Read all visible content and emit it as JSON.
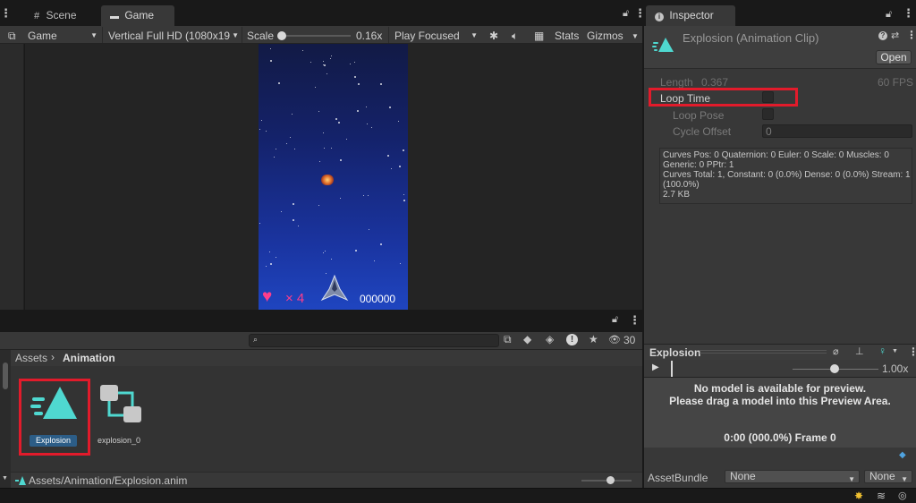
{
  "tabs": {
    "scene": "Scene",
    "game": "Game",
    "inspector": "Inspector"
  },
  "game_toolbar": {
    "display": "Game",
    "resolution": "Vertical Full HD (1080x19",
    "scale_label": "Scale",
    "scale_value": "0.16x",
    "play_mode": "Play Focused",
    "stats": "Stats",
    "gizmos": "Gizmos"
  },
  "game_hud": {
    "lives": "× 4",
    "score": "000000"
  },
  "project": {
    "search_placeholder": "",
    "visible_count": "30",
    "breadcrumb_root": "Assets",
    "breadcrumb_current": "Animation",
    "assets": [
      {
        "name": "Explosion",
        "selected": true,
        "icon": "animation-clip-icon"
      },
      {
        "name": "explosion_0",
        "selected": false,
        "icon": "animator-controller-icon"
      }
    ],
    "footer_path": "Assets/Animation/Explosion.anim"
  },
  "inspector": {
    "title": "Explosion (Animation Clip)",
    "open_button": "Open",
    "length_label": "Length",
    "length_value": "0.367",
    "fps": "60 FPS",
    "loop_time_label": "Loop Time",
    "loop_time_checked": false,
    "loop_pose_label": "Loop Pose",
    "cycle_offset_label": "Cycle Offset",
    "cycle_offset_value": "0",
    "info_line1": "Curves Pos: 0 Quaternion: 0 Euler: 0 Scale: 0 Muscles: 0",
    "info_line2": "Generic: 0 PPtr: 1",
    "info_line3": "Curves Total: 1, Constant: 0 (0.0%) Dense: 0 (0.0%) Stream: 1",
    "info_line4": "(100.0%)",
    "info_line5": "2.7 KB"
  },
  "preview": {
    "title": "Explosion",
    "speed": "1.00x",
    "message_line1": "No model is available for preview.",
    "message_line2": "Please drag a model into this Preview Area.",
    "time": "0:00 (000.0%) Frame 0"
  },
  "asset_bundle": {
    "label": "AssetBundle",
    "name": "None",
    "variant": "None"
  },
  "colors": {
    "accent_cyan": "#4fd8d0",
    "highlight_red": "#e21b2b",
    "selected_label": "#2c5d87"
  }
}
